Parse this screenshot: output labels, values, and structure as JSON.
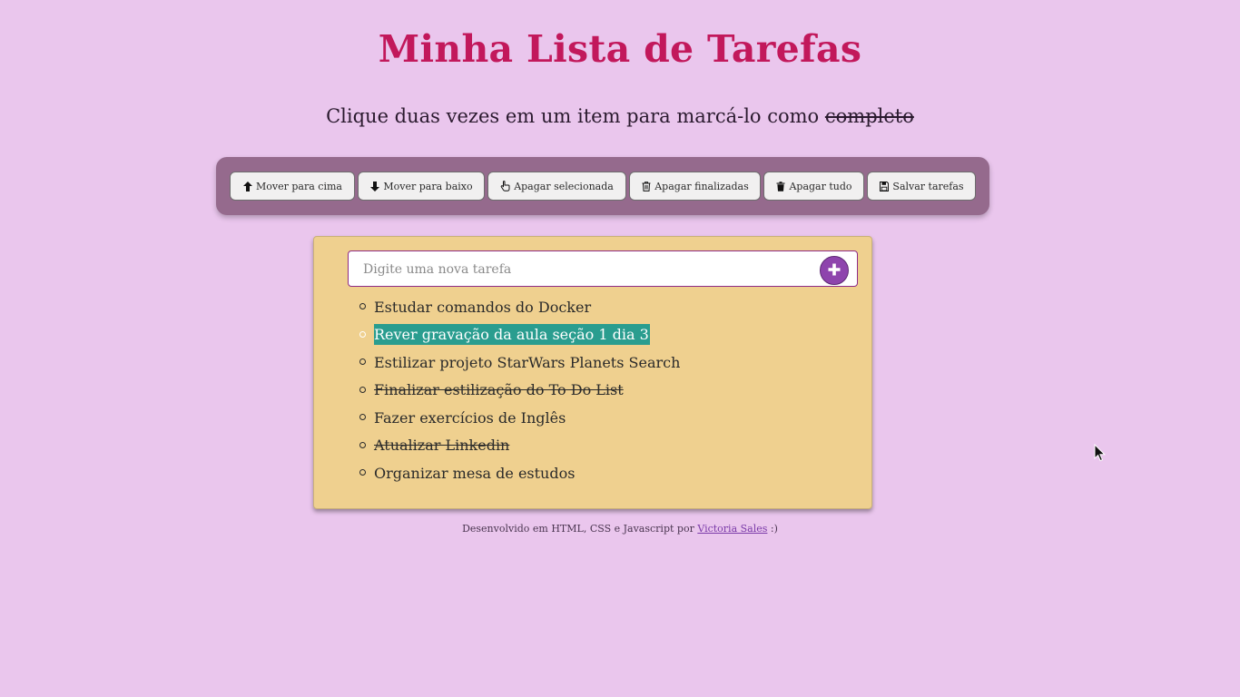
{
  "header": {
    "title": "Minha Lista de Tarefas",
    "subtitle_prefix": "Clique duas vezes em um item para marcá-lo como ",
    "subtitle_strike": "completo"
  },
  "toolbar": {
    "buttons": [
      {
        "label": "Mover para cima",
        "icon": "arrow-up-icon"
      },
      {
        "label": "Mover para baixo",
        "icon": "arrow-down-icon"
      },
      {
        "label": "Apagar selecionada",
        "icon": "hand-pointer-icon"
      },
      {
        "label": "Apagar finalizadas",
        "icon": "trash-outline-icon"
      },
      {
        "label": "Apagar tudo",
        "icon": "trash-icon"
      },
      {
        "label": "Salvar tarefas",
        "icon": "save-icon"
      }
    ]
  },
  "new_task": {
    "placeholder": "Digite uma nova tarefa",
    "value": "",
    "add_icon": "plus-icon"
  },
  "tasks": [
    {
      "text": "Estudar comandos do Docker",
      "completed": false,
      "selected": false
    },
    {
      "text": "Rever gravação da aula seção 1 dia 3",
      "completed": false,
      "selected": true
    },
    {
      "text": "Estilizar projeto StarWars Planets Search",
      "completed": false,
      "selected": false
    },
    {
      "text": "Finalizar estilização do To Do List",
      "completed": true,
      "selected": false
    },
    {
      "text": "Fazer exercícios de Inglês",
      "completed": false,
      "selected": false
    },
    {
      "text": "Atualizar Linkedin",
      "completed": true,
      "selected": false
    },
    {
      "text": "Organizar mesa de estudos",
      "completed": false,
      "selected": false
    }
  ],
  "footer": {
    "prefix": "Desenvolvido em HTML, CSS e Javascript por ",
    "link_text": "Victoria Sales",
    "suffix": " :)"
  },
  "colors": {
    "background": "#eac6ed",
    "title": "#c2185b",
    "toolbar": "#956a8d",
    "card": "#efd08f",
    "selected_highlight": "#2a9d8f",
    "add_button": "#8e44ad"
  }
}
